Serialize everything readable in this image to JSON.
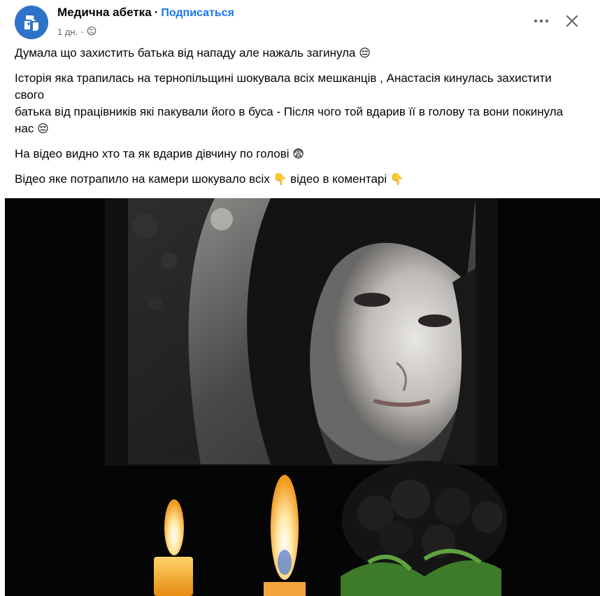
{
  "header": {
    "page_name": "Медична абетка",
    "separator": "·",
    "subscribe_label": "Подписаться",
    "time": "1 дн.",
    "time_separator": "·",
    "privacy_icon": "globe-icon",
    "more_icon": "more-dots-icon",
    "close_icon": "close-icon"
  },
  "post": {
    "paragraph_1": "Думала що захистить  батька від нападу але нажаль  загинула",
    "paragraph_1_emoji": "😔",
    "paragraph_2_line_1": "Історія яка трапилась на тернопільщині шокувала всіх мешканців , Анастасія кинулась захистити свого",
    "paragraph_2_line_2": "батька від працівників які пакували його в буса - Після чого той вдарив її в голову та вони покинула нас",
    "paragraph_2_emoji": "😔",
    "paragraph_3": "На відео видно хто та як вдарив дівчину по голові",
    "paragraph_3_emoji": "😨",
    "paragraph_4_a": "Відео яке потрапило на камери шокувало всіх",
    "paragraph_4_emoji_1": "👇",
    "paragraph_4_b": "відео в коментарі",
    "paragraph_4_emoji_2": "👇"
  },
  "media": {
    "type": "memorial-photo",
    "elements": [
      "portrait-photo",
      "candle-icon",
      "candle-icon",
      "black-roses-bouquet"
    ]
  },
  "colors": {
    "link": "#1877f2",
    "secondary_text": "#65676b",
    "avatar_bg": "#2f73c9",
    "media_bg": "#050505"
  }
}
